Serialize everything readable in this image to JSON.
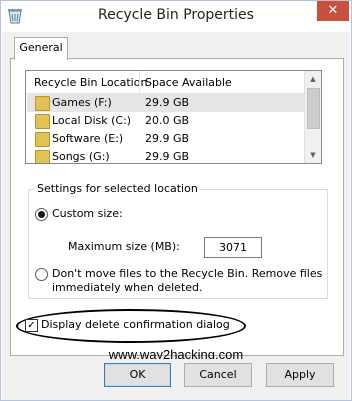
{
  "window": {
    "title": "Recycle Bin Properties",
    "close_glyph": "✕"
  },
  "tabs": [
    {
      "label": "General"
    }
  ],
  "locations": {
    "headers": {
      "location": "Recycle Bin Location",
      "space": "Space Available"
    },
    "rows": [
      {
        "drive": "Games (F:)",
        "space": "29.9 GB",
        "selected": true
      },
      {
        "drive": "Local Disk (C:)",
        "space": "20.0 GB",
        "selected": false
      },
      {
        "drive": "Software (E:)",
        "space": "29.9 GB",
        "selected": false
      },
      {
        "drive": "Songs (G:)",
        "space": "29.9 GB",
        "selected": false
      }
    ]
  },
  "settings": {
    "group_label": "Settings for selected location",
    "custom_size_label": "Custom size:",
    "max_size_label": "Maximum size (MB):",
    "max_size_value": "3071",
    "dont_move_label_line1": "Don't move files to the Recycle Bin. Remove files",
    "dont_move_label_line2": "immediately when deleted.",
    "custom_selected": true
  },
  "confirm": {
    "label": "Display delete confirmation dialog",
    "checked": true
  },
  "watermark": "www.way2hacking.com",
  "buttons": {
    "ok": "OK",
    "cancel": "Cancel",
    "apply": "Apply"
  }
}
